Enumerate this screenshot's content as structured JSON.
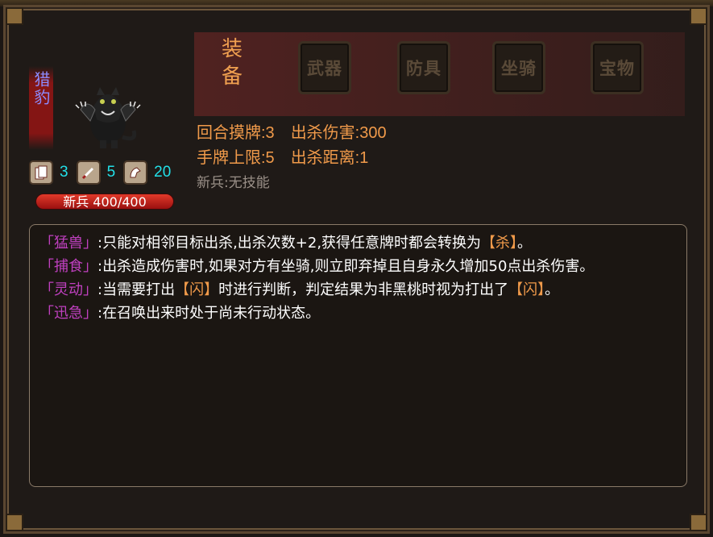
{
  "unit": {
    "name": "猎豹",
    "hp_text": "新兵 400/400",
    "stats": [
      {
        "icon": "card-icon",
        "value": "3"
      },
      {
        "icon": "sword-icon",
        "value": "5"
      },
      {
        "icon": "horse-icon",
        "value": "20"
      }
    ]
  },
  "equipment": {
    "title": "装备",
    "slots": [
      "武器",
      "防具",
      "坐骑",
      "宝物"
    ]
  },
  "info": {
    "row1": [
      "回合摸牌:3",
      "出杀伤害:300"
    ],
    "row2": [
      "手牌上限:5",
      "出杀距离:1"
    ],
    "skill": "新兵:无技能"
  },
  "abilities": [
    {
      "name": "「猛兽」",
      "pre": ":只能对相邻目标出杀,出杀次数+2,获得任意牌时都会转换为",
      "highlight": "【杀】",
      "post": "。"
    },
    {
      "name": "「捕食」",
      "pre": ":出杀造成伤害时,如果对方有坐骑,则立即弃掉且自身永久增加50点出杀伤害。",
      "highlight": "",
      "post": ""
    },
    {
      "name": "「灵动」",
      "pre": ":当需要打出",
      "highlight": "【闪】",
      "post": "时进行判断，判定结果为非黑桃时视为打出了",
      "highlight2": "【闪】",
      "post2": "。"
    },
    {
      "name": "「迅急」",
      "pre": ":在召唤出来时处于尚未行动状态。",
      "highlight": "",
      "post": ""
    }
  ],
  "colors": {
    "accent_orange": "#f09a4a",
    "skill_purple": "#c040c0",
    "stat_cyan": "#22e0e8",
    "name_blue": "#8c8cff",
    "hp_red": "#e23a2a"
  }
}
